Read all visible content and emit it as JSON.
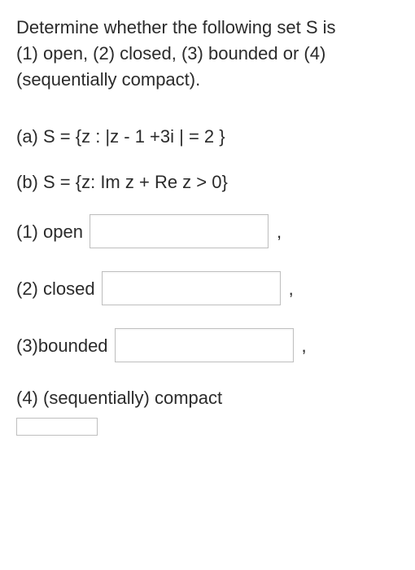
{
  "intro": {
    "line1": "Determine whether the following set S is",
    "line2": "(1) open, (2) closed, (3) bounded or (4)",
    "line3": "(sequentially compact)."
  },
  "parts": {
    "a": "(a) S = {z : |z - 1 +3i | = 2 }",
    "b": "(b) S = {z: Im z + Re z > 0}"
  },
  "answers": {
    "open": {
      "label": "(1) open",
      "value": "",
      "comma": ","
    },
    "closed": {
      "label": "(2) closed",
      "value": "",
      "comma": ","
    },
    "bounded": {
      "label": "(3)bounded",
      "value": "",
      "comma": ","
    },
    "compact": {
      "label": "(4) (sequentially) compact",
      "value": ""
    }
  }
}
